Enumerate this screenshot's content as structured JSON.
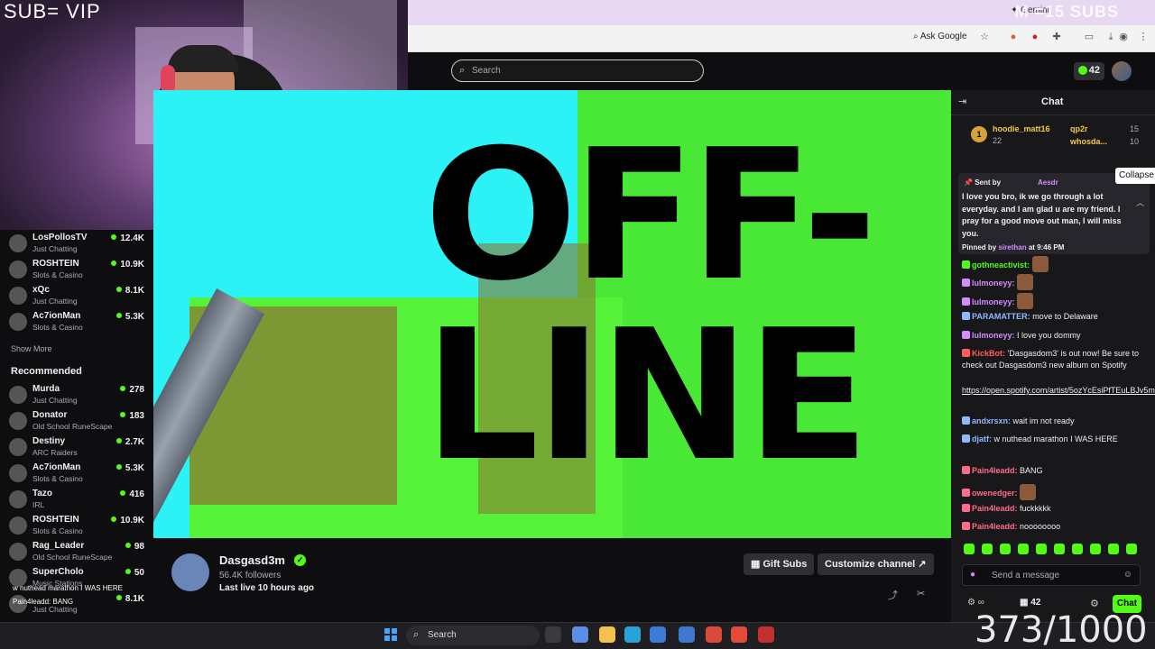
{
  "stream_overlay": {
    "cam_title": "SUB= VIP",
    "top_text": "M     =15 SUBS",
    "counter": "373/1000"
  },
  "browser": {
    "gemini_label": "Gemini",
    "ask_google_label": "Ask Google"
  },
  "header": {
    "search_placeholder": "Search",
    "points": "42"
  },
  "sidebar": {
    "following": [
      {
        "name": "LosPollosTV",
        "game": "Just Chatting",
        "viewers": "12.4K"
      },
      {
        "name": "ROSHTEIN",
        "game": "Slots & Casino",
        "viewers": "10.9K"
      },
      {
        "name": "xQc",
        "game": "Just Chatting",
        "viewers": "8.1K"
      },
      {
        "name": "Ac7ionMan",
        "game": "Slots & Casino",
        "viewers": "5.3K"
      }
    ],
    "show_more": "Show More",
    "recommended_title": "Recommended",
    "recommended": [
      {
        "name": "Murda",
        "game": "Just Chatting",
        "viewers": "278"
      },
      {
        "name": "Donator",
        "game": "Old School RuneScape",
        "viewers": "183"
      },
      {
        "name": "Destiny",
        "game": "ARC Raiders",
        "viewers": "2.7K"
      },
      {
        "name": "Ac7ionMan",
        "game": "Slots & Casino",
        "viewers": "5.3K"
      },
      {
        "name": "Tazo",
        "game": "IRL",
        "viewers": "416"
      },
      {
        "name": "ROSHTEIN",
        "game": "Slots & Casino",
        "viewers": "10.9K"
      },
      {
        "name": "Rag_Leader",
        "game": "Old School RuneScape",
        "viewers": "98"
      },
      {
        "name": "SuperCholo",
        "game": "Music Stations",
        "viewers": "50"
      },
      {
        "name": "",
        "game": "Just Chatting",
        "viewers": "8.1K"
      }
    ],
    "overlay_lines": [
      "w nuthead marathon I WAS HERE",
      "Pain4leadd: BANG",
      "fuckkkkk",
      "noooooooo"
    ]
  },
  "video": {
    "offline_line1": "OFF-",
    "offline_line2": "LINE"
  },
  "channel": {
    "name": "Dasgasd3m",
    "followers": "56.4K followers",
    "last_live": "Last live 10 hours ago",
    "gift_subs": "Gift Subs",
    "customize": "Customize channel"
  },
  "chat": {
    "title": "Chat",
    "gifters": [
      {
        "rank": "1",
        "name": "hoodie_matt16",
        "count": "22"
      },
      {
        "name": "qp2r",
        "count": "15"
      },
      {
        "name": "whosda...",
        "count": "10"
      }
    ],
    "pinned": {
      "sent_by_label": "Sent by",
      "sender": "Aesdr",
      "message": "I love you bro, ik we go through a lot everyday. and I am glad u are my friend. I pray for a good move out man, I will miss you.",
      "pinned_by_label": "Pinned by",
      "pinned_by": "sirethan",
      "pinned_time": "at 9:46 PM"
    },
    "collapse_tooltip": "Collapse",
    "messages": [
      {
        "user": "gothneactivist:",
        "text": "",
        "color": "#53fc18"
      },
      {
        "user": "lulmoneyy:",
        "text": "",
        "color": "#d58aff"
      },
      {
        "user": "lulmoneyy:",
        "text": "",
        "color": "#d58aff"
      },
      {
        "user": "PARAMATTER:",
        "text": "move to Delaware",
        "color": "#8fb8ff"
      },
      {
        "user": "lulmoneyy:",
        "text": "I love you dommy",
        "color": "#d58aff"
      },
      {
        "user": "KickBot:",
        "text": "'Dasgasdom3' is out now! Be sure to check out Dasgasdom3 new album on Spotify",
        "color": "#ff5c5c"
      },
      {
        "user": "",
        "text": "https://open.spotify.com/artist/5ozYcEsiPfTEuLBJv5mlln",
        "color": "#efeff1"
      },
      {
        "user": "andxrsxn:",
        "text": "wait im not ready",
        "color": "#8fb8ff"
      },
      {
        "user": "djatf:",
        "text": "w nuthead marathon I WAS HERE",
        "color": "#8fb8ff"
      },
      {
        "user": "Pain4leadd:",
        "text": "BANG",
        "color": "#ff6b8b"
      },
      {
        "user": "owenedger:",
        "text": "",
        "color": "#ff6b8b"
      },
      {
        "user": "Pain4leadd:",
        "text": "fuckkkkk",
        "color": "#ff6b8b"
      },
      {
        "user": "Pain4leadd:",
        "text": "noooooooo",
        "color": "#ff6b8b"
      }
    ],
    "send_placeholder": "Send a message",
    "viewer_count": "42",
    "chat_button": "Chat"
  },
  "taskbar": {
    "search_label": "Search"
  },
  "colors": {
    "accent": "#53fc18",
    "background": "#0e0e10",
    "chat_bg": "#18181b"
  }
}
